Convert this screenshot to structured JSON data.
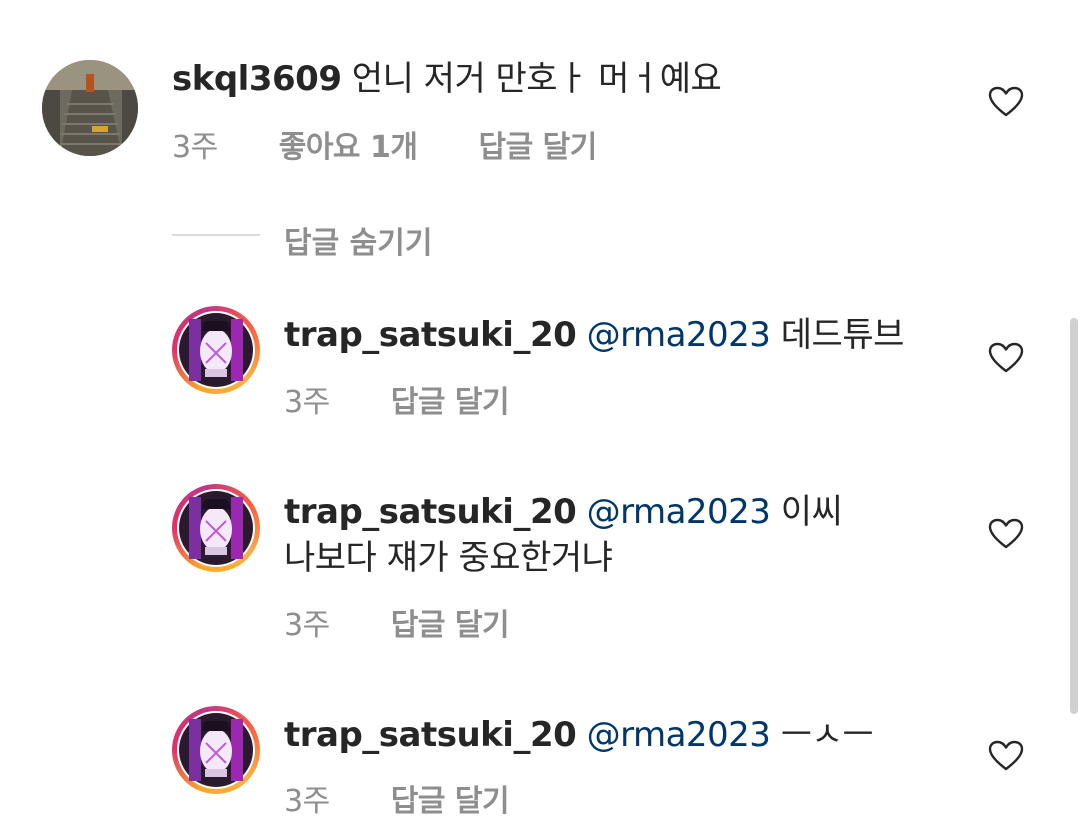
{
  "comments": [
    {
      "username": "skql3609",
      "mention": "",
      "text": "언니 저거 만호ㅏ 머ㅓ예요",
      "time": "3주",
      "likes": "좋아요 1개",
      "reply": "답글 달기"
    }
  ],
  "hide_replies": "답글 숨기기",
  "replies": [
    {
      "username": "trap_satsuki_20",
      "mention": "@rma2023",
      "text": "데드튜브",
      "text2": "",
      "time": "3주",
      "reply": "답글 달기"
    },
    {
      "username": "trap_satsuki_20",
      "mention": "@rma2023",
      "text": "이씨",
      "text2": "나보다 쟤가 중요한거냐",
      "time": "3주",
      "reply": "답글 달기"
    },
    {
      "username": "trap_satsuki_20",
      "mention": "@rma2023",
      "text": "ㅡㅅㅡ",
      "text2": "",
      "time": "3주",
      "reply": "답글 달기"
    }
  ],
  "colors": {
    "mention": "#00376b",
    "meta": "#8e8e8e",
    "text": "#262626"
  },
  "icons": [
    "heart-outline-icon"
  ]
}
